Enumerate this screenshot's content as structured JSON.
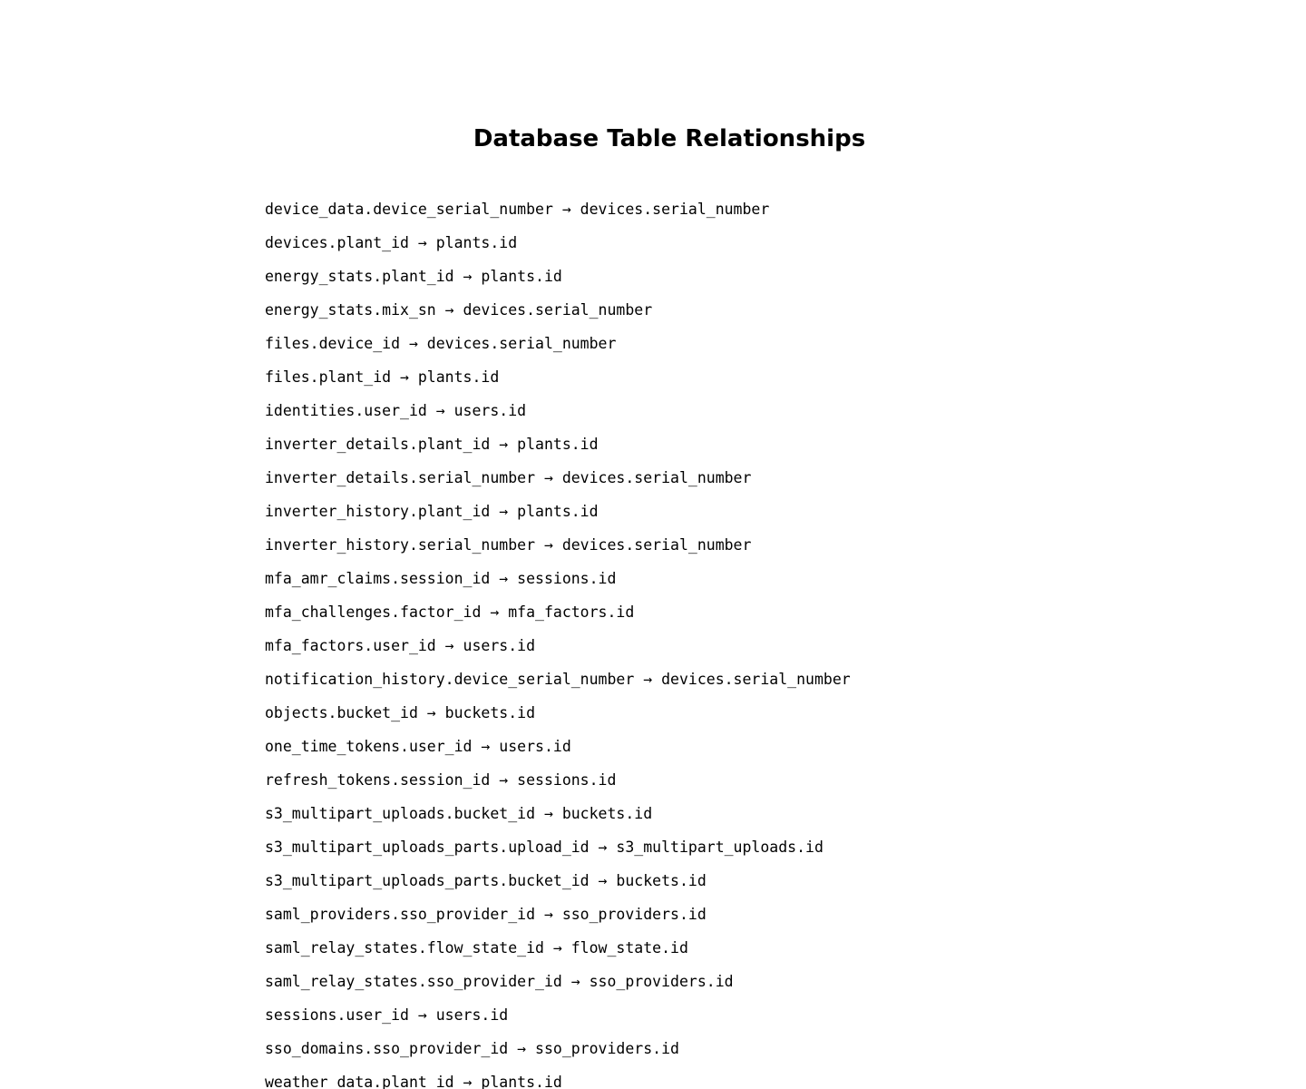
{
  "page": {
    "title": "Database Table Relationships"
  },
  "relationships": [
    "device_data.device_serial_number → devices.serial_number",
    "devices.plant_id → plants.id",
    "energy_stats.plant_id → plants.id",
    "energy_stats.mix_sn → devices.serial_number",
    "files.device_id → devices.serial_number",
    "files.plant_id → plants.id",
    "identities.user_id → users.id",
    "inverter_details.plant_id → plants.id",
    "inverter_details.serial_number → devices.serial_number",
    "inverter_history.plant_id → plants.id",
    "inverter_history.serial_number → devices.serial_number",
    "mfa_amr_claims.session_id → sessions.id",
    "mfa_challenges.factor_id → mfa_factors.id",
    "mfa_factors.user_id → users.id",
    "notification_history.device_serial_number → devices.serial_number",
    "objects.bucket_id → buckets.id",
    "one_time_tokens.user_id → users.id",
    "refresh_tokens.session_id → sessions.id",
    "s3_multipart_uploads.bucket_id → buckets.id",
    "s3_multipart_uploads_parts.upload_id → s3_multipart_uploads.id",
    "s3_multipart_uploads_parts.bucket_id → buckets.id",
    "saml_providers.sso_provider_id → sso_providers.id",
    "saml_relay_states.flow_state_id → flow_state.id",
    "saml_relay_states.sso_provider_id → sso_providers.id",
    "sessions.user_id → users.id",
    "sso_domains.sso_provider_id → sso_providers.id",
    "weather_data.plant_id → plants.id"
  ]
}
